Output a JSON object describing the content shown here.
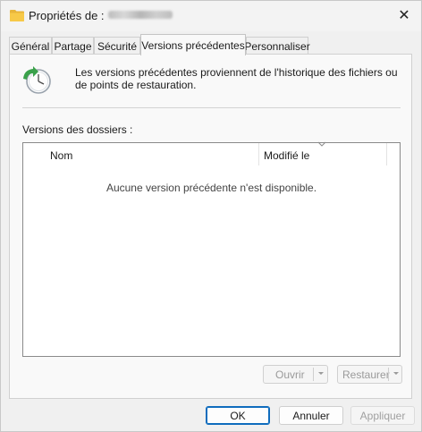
{
  "window": {
    "title": "Propriétés de :",
    "title_folder_name_visible": false
  },
  "tabs": [
    {
      "label": "Général",
      "active": false
    },
    {
      "label": "Partage",
      "active": false
    },
    {
      "label": "Sécurité",
      "active": false
    },
    {
      "label": "Versions précédentes",
      "active": true
    },
    {
      "label": "Personnaliser",
      "active": false
    }
  ],
  "info": {
    "text": "Les versions précédentes proviennent de l'historique des fichiers ou de points de restauration."
  },
  "versions": {
    "section_label": "Versions des dossiers :",
    "columns": [
      "Nom",
      "Modifié le"
    ],
    "empty_message": "Aucune version précédente n'est disponible.",
    "rows": []
  },
  "actions": {
    "open_label": "Ouvrir",
    "restore_label": "Restaurer"
  },
  "footer": {
    "ok_label": "OK",
    "cancel_label": "Annuler",
    "apply_label": "Appliquer"
  },
  "colors": {
    "accent": "#0f6cbd",
    "folder": "#f7c948",
    "history_icon_green": "#3aa14a"
  }
}
